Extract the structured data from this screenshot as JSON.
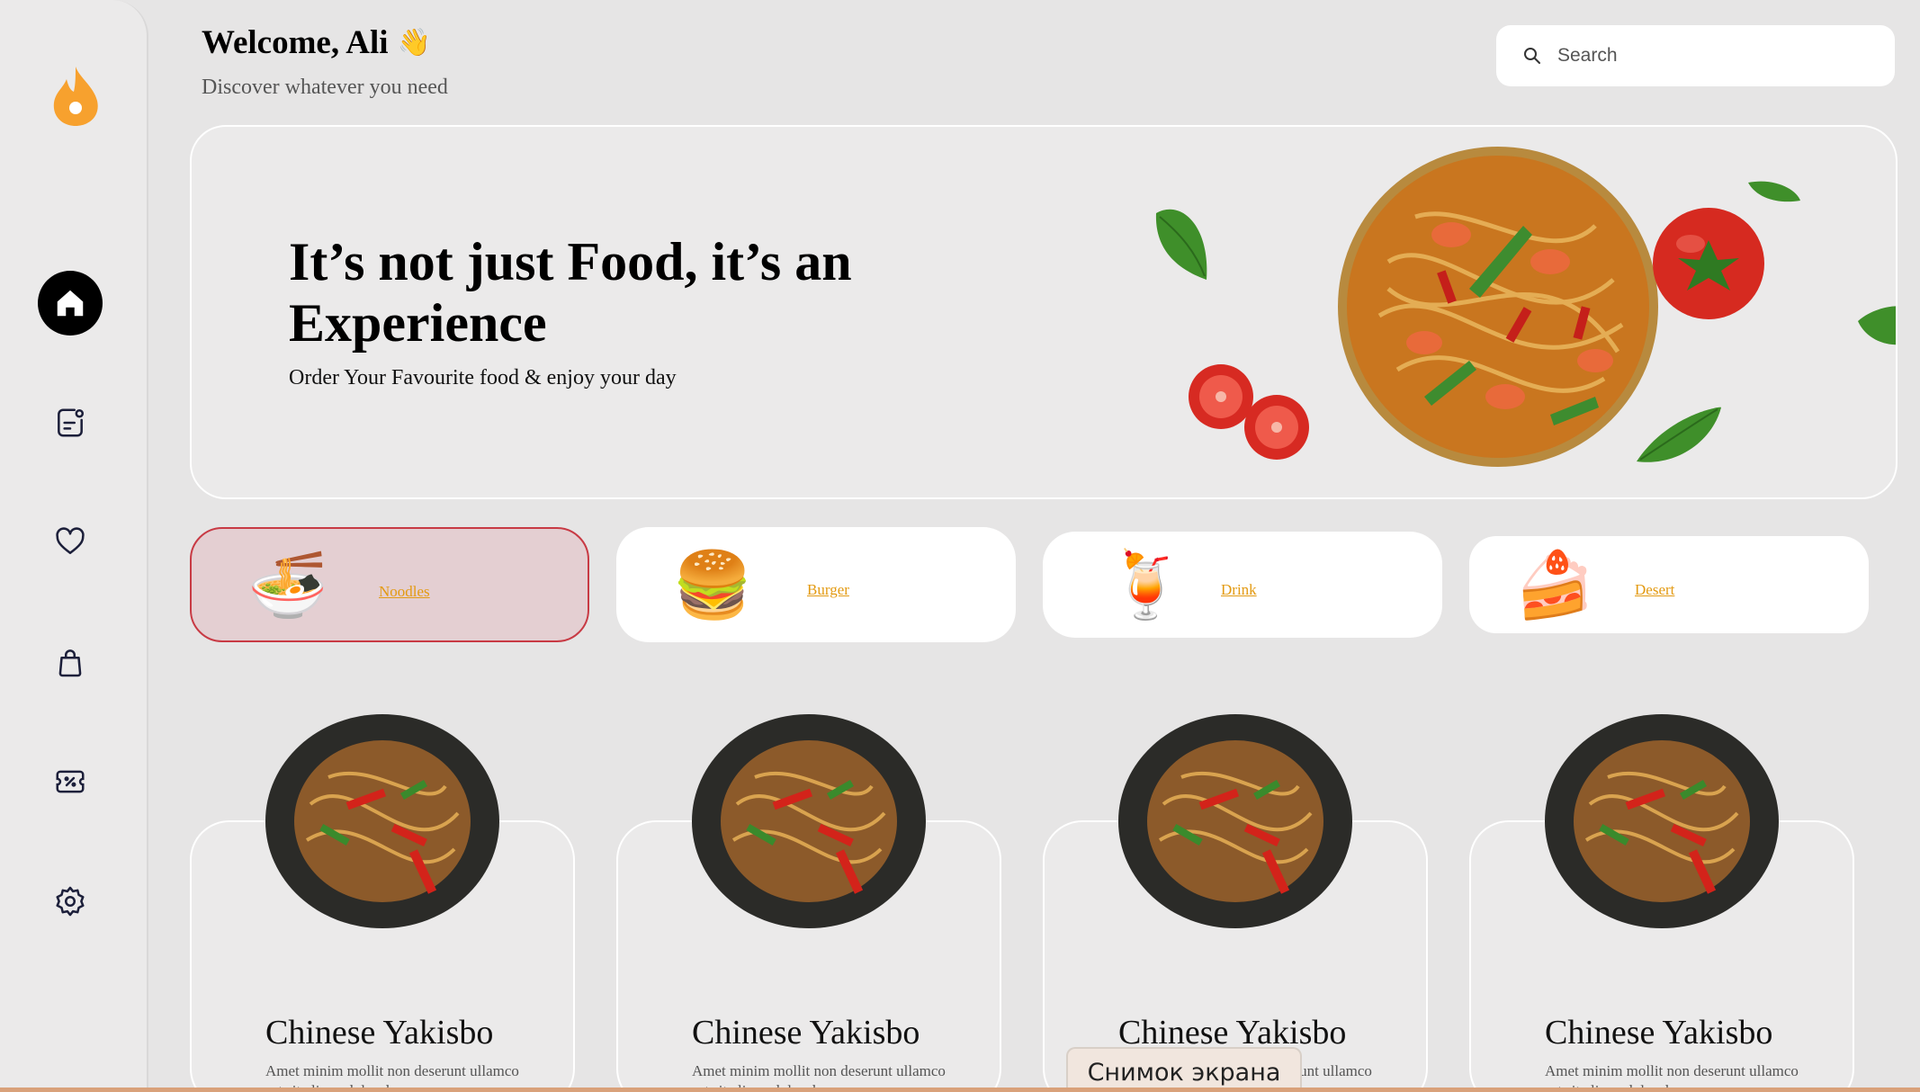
{
  "header": {
    "welcome": "Welcome, Ali",
    "wave_emoji": "👋",
    "subtitle": "Discover whatever you need"
  },
  "search": {
    "placeholder": "Search",
    "icon": "search-icon"
  },
  "sidebar": {
    "logo": "flame-logo",
    "items": [
      {
        "name": "home",
        "icon": "home-icon",
        "active": true
      },
      {
        "name": "orders",
        "icon": "receipt-icon",
        "active": false
      },
      {
        "name": "favorites",
        "icon": "heart-icon",
        "active": false
      },
      {
        "name": "bag",
        "icon": "bag-icon",
        "active": false
      },
      {
        "name": "coupons",
        "icon": "ticket-icon",
        "active": false
      },
      {
        "name": "settings",
        "icon": "gear-icon",
        "active": false
      }
    ]
  },
  "hero": {
    "title": "It’s not just Food, it’s an Experience",
    "subtitle": "Order Your Favourite food & enjoy your day"
  },
  "categories": [
    {
      "label": "Noodles",
      "emoji": "🍜",
      "active": true
    },
    {
      "label": "Burger",
      "emoji": "🍔",
      "active": false
    },
    {
      "label": "Drink",
      "emoji": "🍹",
      "active": false
    },
    {
      "label": "Desert",
      "emoji": "🍰",
      "active": false
    }
  ],
  "cards": [
    {
      "title": "Chinese Yakisbo",
      "desc": "Amet minim mollit non deserunt ullamco est sit aliqua dolor do"
    },
    {
      "title": "Chinese Yakisbo",
      "desc": "Amet minim mollit non deserunt ullamco est sit aliqua dolor do"
    },
    {
      "title": "Chinese Yakisbo",
      "desc": "Amet minim mollit non deserunt ullamco est sit aliqua dolor do"
    },
    {
      "title": "Chinese Yakisbo",
      "desc": "Amet minim mollit non deserunt ullamco est sit aliqua dolor do"
    }
  ],
  "overlay": {
    "screenshot_label": "Снимок экрана"
  },
  "colors": {
    "accent_orange": "#f7a12e",
    "active_red": "#c83a44",
    "link": "#e39a12"
  }
}
